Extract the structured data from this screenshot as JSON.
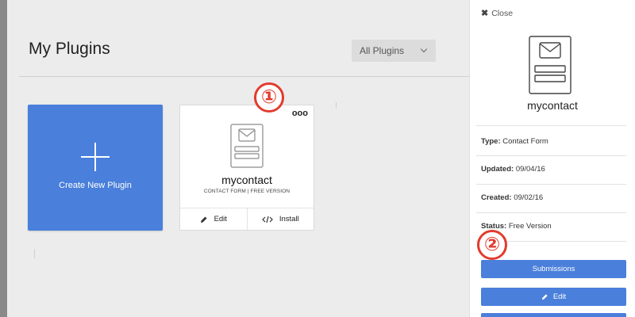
{
  "page": {
    "title": "My Plugins",
    "filter": {
      "selected": "All Plugins"
    }
  },
  "create_card": {
    "label": "Create New Plugin"
  },
  "plugin": {
    "name": "mycontact",
    "meta": "CONTACT FORM | FREE VERSION",
    "more_glyph": "ooo",
    "edit_label": "Edit",
    "install_label": "Install"
  },
  "badges": {
    "one": "①",
    "two": "②"
  },
  "side_panel": {
    "close_label": "Close",
    "name": "mycontact",
    "type_label": "Type:",
    "type_value": "Contact Form",
    "updated_label": "Updated:",
    "updated_value": "09/04/16",
    "created_label": "Created:",
    "created_value": "09/02/16",
    "status_label": "Status:",
    "status_value": "Free Version",
    "submissions_label": "Submissions",
    "edit_label": "Edit"
  },
  "colors": {
    "accent": "#4a7fdb",
    "badge": "#e23b2e"
  }
}
